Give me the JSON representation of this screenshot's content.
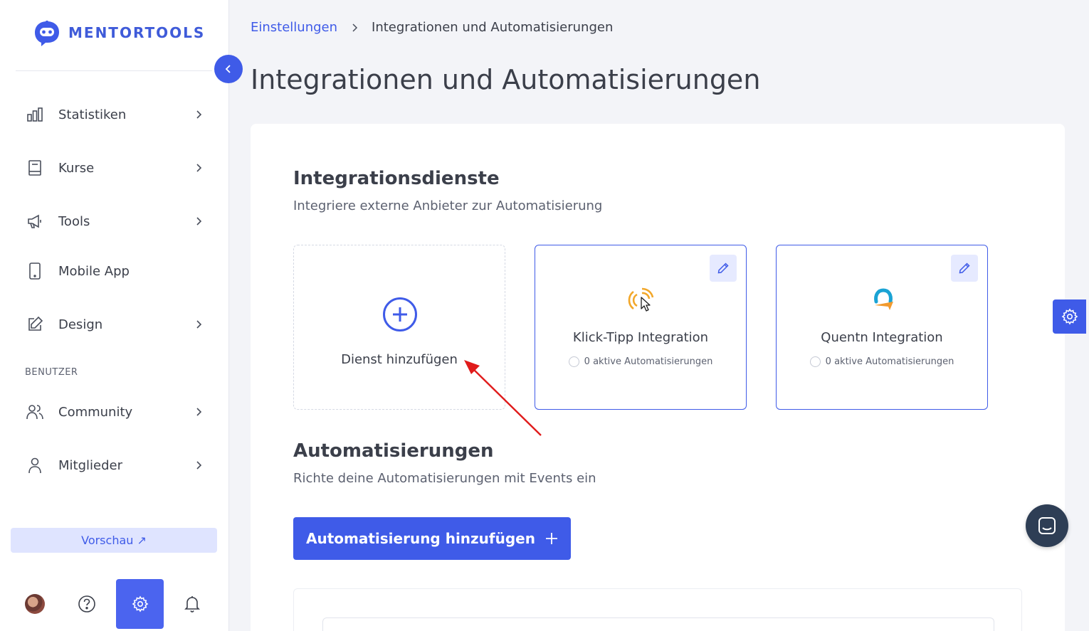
{
  "brand": {
    "name": "MENTORTOOLS",
    "color": "#3f5be8"
  },
  "sidebar": {
    "items": [
      {
        "label": "Statistiken",
        "icon": "bar-chart-icon",
        "has_chevron": true
      },
      {
        "label": "Kurse",
        "icon": "book-icon",
        "has_chevron": true
      },
      {
        "label": "Tools",
        "icon": "megaphone-icon",
        "has_chevron": true
      },
      {
        "label": "Mobile App",
        "icon": "mobile-icon",
        "has_chevron": false
      },
      {
        "label": "Design",
        "icon": "edit-icon",
        "has_chevron": true
      }
    ],
    "section_label": "BENUTZER",
    "user_items": [
      {
        "label": "Community",
        "icon": "users-icon",
        "has_chevron": true
      },
      {
        "label": "Mitglieder",
        "icon": "user-icon",
        "has_chevron": true
      }
    ],
    "preview_label": "Vorschau ↗"
  },
  "breadcrumb": {
    "link": "Einstellungen",
    "current": "Integrationen und Automatisierungen"
  },
  "page_title": "Integrationen und Automatisierungen",
  "integrations": {
    "title": "Integrationsdienste",
    "subtitle": "Integriere externe Anbieter zur Automatisierung",
    "add_label": "Dienst hinzufügen",
    "cards": [
      {
        "name": "Klick-Tipp Integration",
        "status": "0 aktive Automatisierungen"
      },
      {
        "name": "Quentn Integration",
        "status": "0 aktive Automatisierungen"
      }
    ]
  },
  "automations": {
    "title": "Automatisierungen",
    "subtitle": "Richte deine Automatisierungen mit Events ein",
    "add_button": "Automatisierung hinzufügen"
  },
  "colors": {
    "accent": "#3f5be8",
    "accent_light": "#dfe4ff",
    "annotation": "#e01b1b"
  }
}
